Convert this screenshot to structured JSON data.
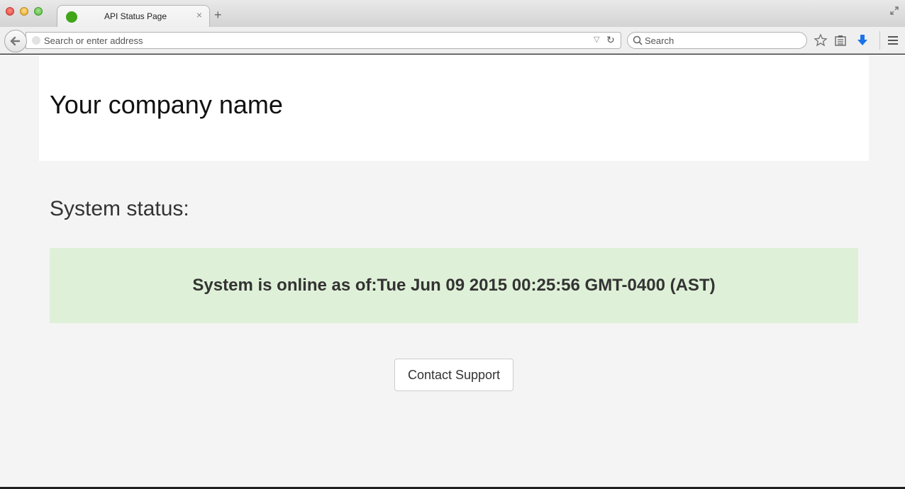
{
  "browser": {
    "tab_title": "API Status Page",
    "tab_close": "×",
    "new_tab": "+",
    "address_placeholder": "Search or enter address",
    "search_placeholder": "Search",
    "url_dropdown_glyph": "▽",
    "reload_glyph": "↻"
  },
  "page": {
    "company_name": "Your company name",
    "status_heading": "System status:",
    "status_message": "System is online as of:Tue Jun 09 2015 00:25:56 GMT-0400 (AST)",
    "contact_button": "Contact Support"
  },
  "colors": {
    "status_ok_background": "#dff0d8",
    "favicon_green": "#41a51a",
    "download_blue": "#1a73e8"
  },
  "icons": [
    "back-arrow-icon",
    "globe-icon",
    "dropdown-icon",
    "reload-icon",
    "search-icon",
    "bookmark-star-icon",
    "reading-list-icon",
    "download-icon",
    "menu-icon",
    "fullscreen-icon"
  ]
}
